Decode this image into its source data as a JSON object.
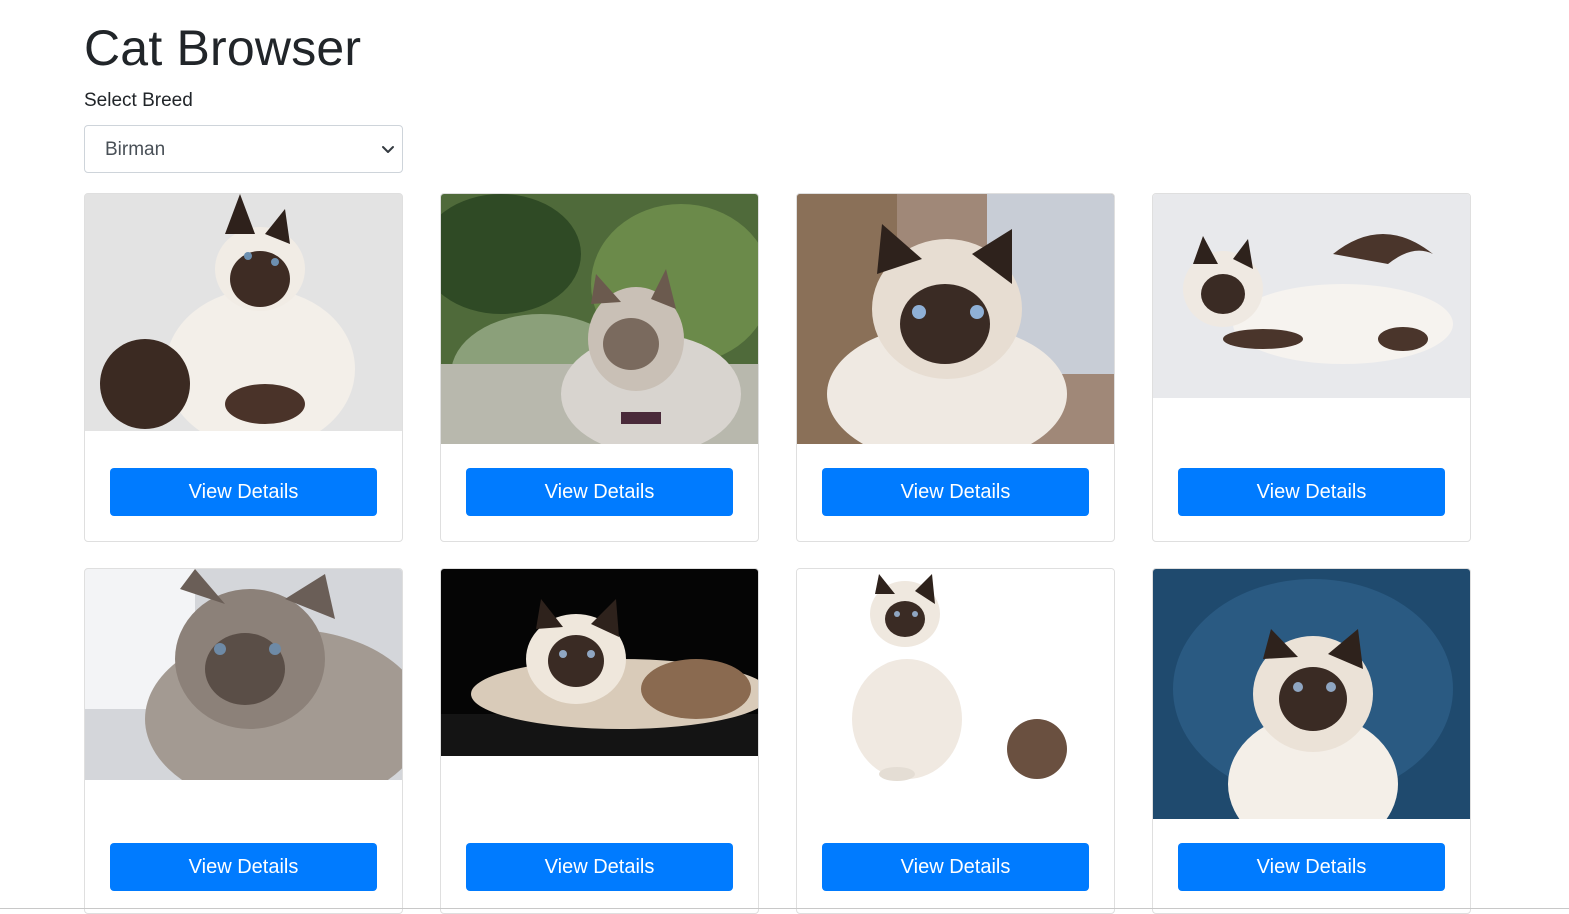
{
  "page": {
    "title": "Cat Browser"
  },
  "breed_selector": {
    "label": "Select Breed",
    "selected": "Birman"
  },
  "cards": [
    {
      "button_label": "View Details",
      "image": "birman-cat-photo"
    },
    {
      "button_label": "View Details",
      "image": "birman-cat-photo"
    },
    {
      "button_label": "View Details",
      "image": "birman-cat-photo"
    },
    {
      "button_label": "View Details",
      "image": "birman-cat-photo"
    },
    {
      "button_label": "View Details",
      "image": "birman-cat-photo"
    },
    {
      "button_label": "View Details",
      "image": "birman-cat-photo"
    },
    {
      "button_label": "View Details",
      "image": "birman-cat-photo"
    },
    {
      "button_label": "View Details",
      "image": "birman-cat-photo"
    }
  ],
  "colors": {
    "primary": "#007bff",
    "text": "#212529",
    "border": "#dfdfdf"
  }
}
